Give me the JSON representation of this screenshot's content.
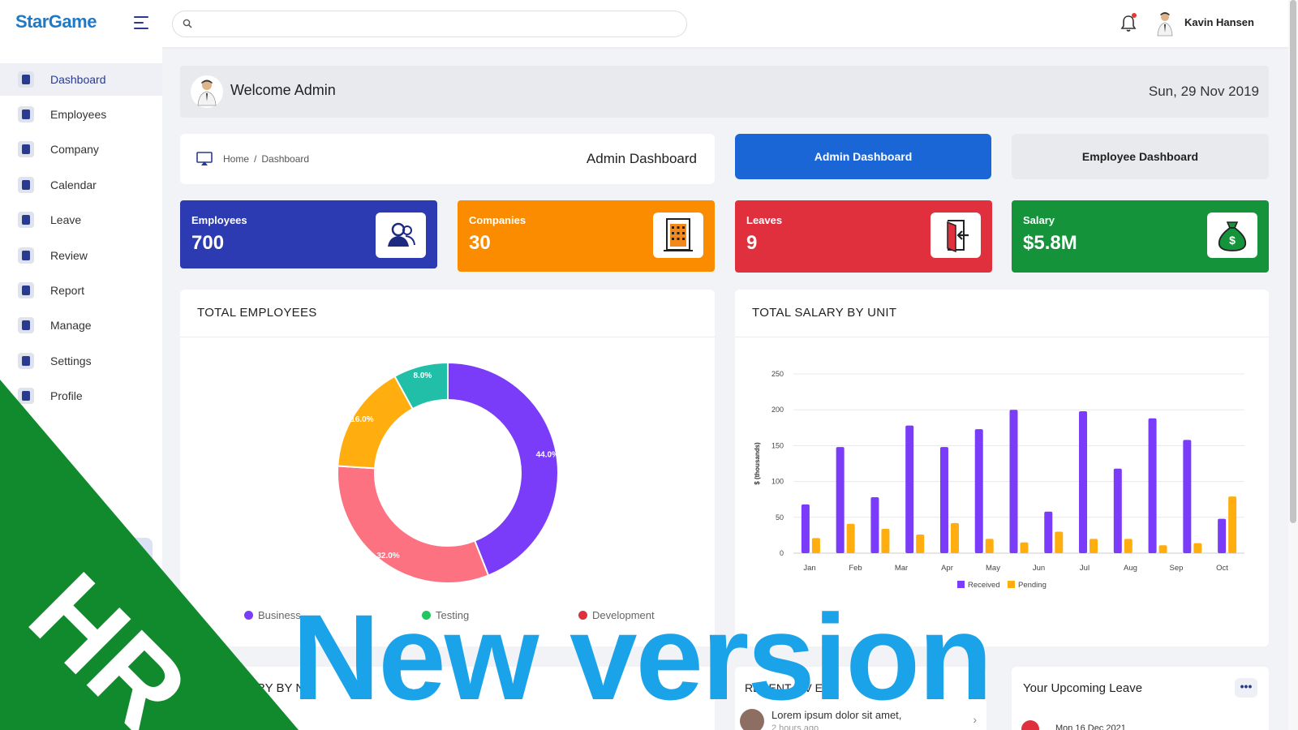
{
  "app": {
    "brand": "StarGame"
  },
  "header": {
    "search_placeholder": "",
    "user_name": "Kavin Hansen"
  },
  "sidebar": {
    "items": [
      {
        "label": "Dashboard",
        "icon": "home-icon",
        "active": true
      },
      {
        "label": "Employees",
        "icon": "employees-icon"
      },
      {
        "label": "Company",
        "icon": "company-icon"
      },
      {
        "label": "Calendar",
        "icon": "calendar-icon"
      },
      {
        "label": "Leave",
        "icon": "leave-icon"
      },
      {
        "label": "Review",
        "icon": "review-icon"
      },
      {
        "label": "Report",
        "icon": "report-icon"
      },
      {
        "label": "Manage",
        "icon": "sliders-icon"
      },
      {
        "label": "Settings",
        "icon": "gear-icon"
      },
      {
        "label": "Profile",
        "icon": "profile-icon"
      }
    ]
  },
  "welcome": {
    "text": "Welcome Admin",
    "date": "Sun, 29 Nov 2019"
  },
  "breadcrumb": {
    "home": "Home",
    "current": "Dashboard",
    "title": "Admin Dashboard"
  },
  "switcher": {
    "admin": "Admin Dashboard",
    "employee": "Employee Dashboard"
  },
  "stats": [
    {
      "label": "Employees",
      "value": "700",
      "color": "#2c3bb2",
      "icon": "users-icon"
    },
    {
      "label": "Companies",
      "value": "30",
      "color": "#fb8c00",
      "icon": "building-icon"
    },
    {
      "label": "Leaves",
      "value": "9",
      "color": "#e0303e",
      "icon": "exit-door-icon"
    },
    {
      "label": "Salary",
      "value": "$5.8M",
      "color": "#15933b",
      "icon": "money-bag-icon"
    }
  ],
  "panels": {
    "employees_title": "TOTAL EMPLOYEES",
    "salary_title": "TOTAL SALARY BY UNIT",
    "bottom_left_title": "ARY BY NIT",
    "recent_title": "RECENT TIV ES",
    "upcoming_title": "Your Upcoming Leave",
    "more_label": "•••"
  },
  "activity": {
    "text": "Lorem ipsum dolor sit amet,",
    "time": "2 hours ago"
  },
  "upcoming": {
    "date": "Mon 16 Dec 2021"
  },
  "chart_data": [
    {
      "type": "pie",
      "title": "TOTAL EMPLOYEES",
      "slices": [
        {
          "name": "",
          "value": 44.0,
          "label": "44.0%",
          "color": "#7a3cf8"
        },
        {
          "name": "Development",
          "value": 32.0,
          "label": "32.0%",
          "color": "#fc7280"
        },
        {
          "name": "",
          "value": 16.0,
          "label": "16.0%",
          "color": "#ffad0f"
        },
        {
          "name": "",
          "value": 8.0,
          "label": "8.0%",
          "color": "#21bfa8"
        }
      ],
      "legend": [
        {
          "name": "Business",
          "color": "#7a3cf8"
        },
        {
          "name": "Testing",
          "color": "#22c55e"
        },
        {
          "name": "Development",
          "color": "#e0303e"
        }
      ],
      "legend_position": "bottom"
    },
    {
      "type": "bar",
      "title": "TOTAL SALARY BY UNIT",
      "categories": [
        "Jan",
        "Feb",
        "Mar",
        "Apr",
        "May",
        "Jun",
        "Jul",
        "Aug",
        "Sep",
        "Oct"
      ],
      "series": [
        {
          "name": "Received",
          "color": "#7a3cf8",
          "values": [
            68,
            148,
            78,
            178,
            148,
            173,
            200,
            58,
            198,
            118,
            188,
            158,
            48
          ]
        },
        {
          "name": "Pending",
          "color": "#ffad0f",
          "values": [
            21,
            41,
            34,
            26,
            42,
            20,
            15,
            30,
            20,
            20,
            11,
            14,
            79
          ]
        }
      ],
      "ylabel": "$ (thousands)",
      "yticks": [
        0,
        50,
        100,
        150,
        200,
        250
      ],
      "ylim": [
        0,
        250
      ],
      "grid": true,
      "legend_position": "bottom"
    }
  ],
  "overlay": {
    "corner_text": "HR",
    "headline": "New version",
    "corner_color": "#118a2e",
    "headline_color": "#1aa3e8"
  }
}
